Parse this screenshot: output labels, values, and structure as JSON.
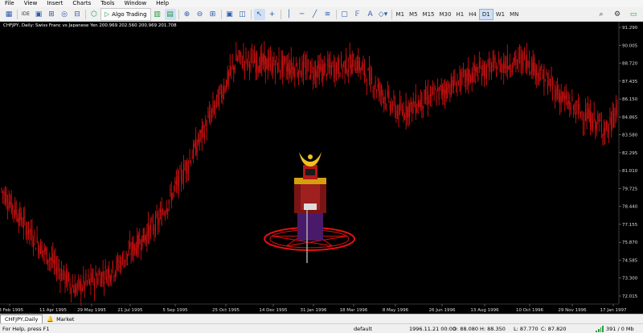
{
  "menu": [
    "File",
    "View",
    "Insert",
    "Charts",
    "Tools",
    "Window",
    "Help"
  ],
  "toolbar": {
    "algo_label": "Algo Trading",
    "timeframes": [
      "M1",
      "M5",
      "M15",
      "M30",
      "H1",
      "H4",
      "D1",
      "W1",
      "MN"
    ],
    "active_timeframe": "D1",
    "icons": [
      "chart-icon",
      "ide-icon",
      "profiles-icon",
      "grid-icon",
      "signals-icon",
      "market-icon",
      "algo-play-icon",
      "one-click-icon",
      "chart-shift-icon",
      "zoom-in-icon",
      "zoom-out-icon",
      "tile-icon",
      "screenshot-icon",
      "template-icon",
      "cursor-icon",
      "crosshair-icon",
      "vertical-line-icon",
      "horizontal-line-icon",
      "trendline-icon",
      "channel-icon",
      "rectangle-icon",
      "fibonacci-icon",
      "shapes-icon",
      "search-icon",
      "settings-icon"
    ]
  },
  "chart": {
    "title": "CHFJPY, Daily:  Swiss Franc vs Japanese Yen  200.969 202.560 200.969 201.708",
    "background": "#000000",
    "candle_color": "#cc1111",
    "price_labels": [
      "91.290",
      "90.005",
      "88.720",
      "87.435",
      "86.150",
      "84.865",
      "83.580",
      "82.295",
      "81.010",
      "79.725",
      "78.440",
      "77.155",
      "75.870",
      "74.585",
      "73.300",
      "72.015"
    ],
    "date_labels": [
      "23 Feb 1995",
      "11 Apr 1995",
      "29 May 1995",
      "21 Jul 1995",
      "5 Sep 1995",
      "25 Oct 1995",
      "14 Dec 1995",
      "31 Jan 1996",
      "18 Mar 1996",
      "8 May 1996",
      "26 Jun 1996",
      "13 Aug 1996",
      "10 Oct 1996",
      "29 Nov 1996",
      "17 Jan 1997"
    ]
  },
  "chart_data": {
    "type": "candlestick",
    "title": "CHFJPY, Daily",
    "symbol": "CHFJPY",
    "period": "Daily",
    "x": [
      "1995-01-10",
      "1995-02-23",
      "1995-04-11",
      "1995-05-29",
      "1995-07-21",
      "1995-09-05",
      "1995-10-25",
      "1995-12-14",
      "1996-01-31",
      "1996-03-18",
      "1996-05-08",
      "1996-06-26",
      "1996-08-13",
      "1996-10-10",
      "1996-11-29",
      "1997-01-17",
      "1997-01-30"
    ],
    "values": [
      80.0,
      76.0,
      72.5,
      74.0,
      77.5,
      83.0,
      89.5,
      89.0,
      88.6,
      89.2,
      85.5,
      87.0,
      88.6,
      89.5,
      86.2,
      84.2,
      86.2
    ],
    "ylim": [
      71.4,
      92.0
    ]
  },
  "tabs": [
    {
      "label": "CHFJPY,Daily",
      "active": true
    },
    {
      "label": "Market",
      "active": false
    }
  ],
  "status": {
    "help": "For Help, press F1",
    "profile": "default",
    "datetime": "1996.11.21 00:00",
    "open": "O: 88.080",
    "high": "H: 88.350",
    "low": "L: 87.770",
    "close": "C: 87.820",
    "traffic": "391 / 0 Mb"
  }
}
